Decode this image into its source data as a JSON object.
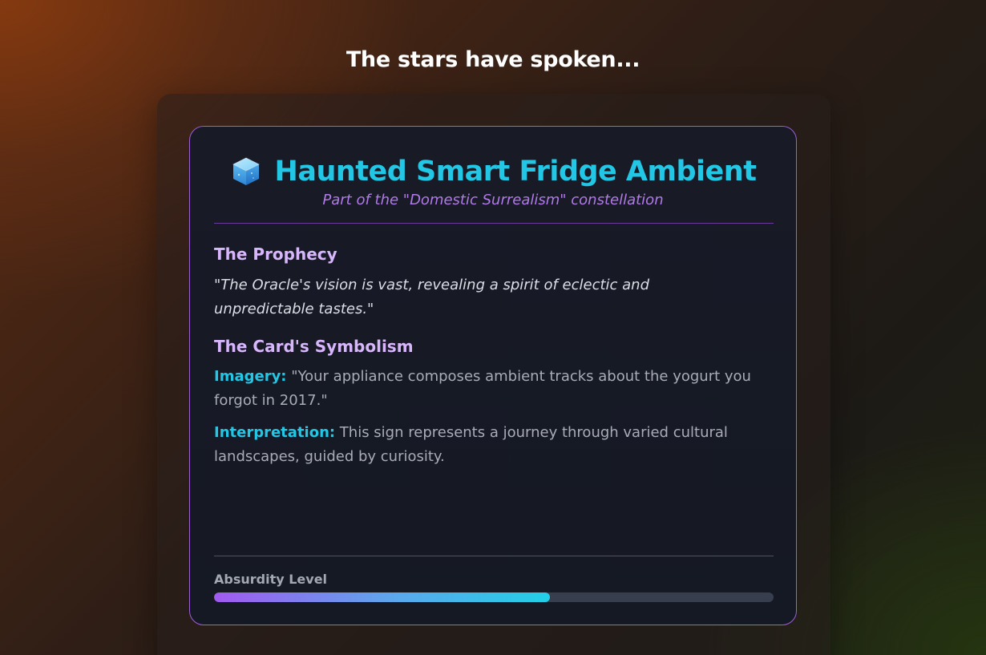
{
  "page": {
    "heading": "The stars have spoken..."
  },
  "card": {
    "icon": "ice-cube-icon",
    "title": "Haunted Smart Fridge Ambient",
    "subtitle": "Part of the \"Domestic Surrealism\" constellation",
    "prophecy": {
      "title": "The Prophecy",
      "text": "\"The Oracle's vision is vast, revealing a spirit of eclectic and unpredictable tastes.\""
    },
    "symbolism": {
      "title": "The Card's Symbolism",
      "imagery_label": "Imagery:",
      "imagery_text": " \"Your appliance composes ambient tracks about the yogurt you forgot in 2017.\"",
      "interpretation_label": "Interpretation:",
      "interpretation_text": " This sign represents a journey through varied cultural landscapes, guided by curiosity."
    },
    "absurdity": {
      "label": "Absurdity Level",
      "level_fraction": 0.6
    }
  },
  "colors": {
    "accent_cyan": "#22c7e6",
    "accent_purple": "#b07ae8",
    "section_title": "#d8b6fb",
    "card_border": "#9b5fd6"
  }
}
